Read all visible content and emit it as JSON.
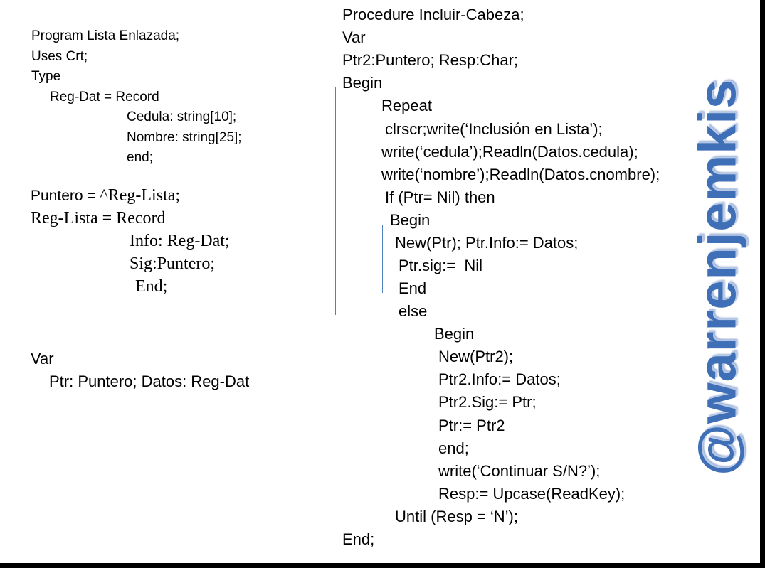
{
  "left_code": {
    "program": "Program Lista Enlazada;",
    "uses": "Uses Crt;",
    "type": "Type",
    "regdat": "Reg-Dat = Record",
    "cedula": "Cedula: string[10];",
    "nombre": "Nombre: string[25];",
    "end1": "end;",
    "puntero_a": "Puntero = ",
    "puntero_b": "^Reg-Lista;",
    "reglista": "Reg-Lista = Record",
    "info": "Info: Reg-Dat;",
    "sig": "Sig:Puntero;",
    "end2": "End;",
    "var": "Var",
    "vardecl": "Ptr: Puntero; Datos: Reg-Dat"
  },
  "right_code": {
    "l01": "Procedure Incluir-Cabeza;",
    "l02": "Var",
    "l03": "Ptr2:Puntero; Resp:Char;",
    "l04": "Begin",
    "l05": "Repeat",
    "l06": "clrscr;write(‘Inclusión en Lista’);",
    "l07": "write(‘cedula’);Readln(Datos.cedula);",
    "l08": "write(‘nombre’);Readln(Datos.cnombre);",
    "l09": "If (Ptr= Nil) then",
    "l10": "Begin",
    "l11": "New(Ptr); Ptr.Info:= Datos;",
    "l12": "Ptr.sig:=  Nil",
    "l13": "End",
    "l14": "else",
    "l15": "Begin",
    "l16": "New(Ptr2);",
    "l17": "Ptr2.Info:= Datos;",
    "l18": "Ptr2.Sig:= Ptr;",
    "l19": "Ptr:= Ptr2",
    "l20": "end;",
    "l21": "write(‘Continuar S/N?’);",
    "l22": "Resp:= Upcase(ReadKey);",
    "l23": "Until (Resp = ‘N’);",
    "l24": "End;"
  },
  "watermark": "@warrenjemkis",
  "colors": {
    "watermark": "#3f6fb6",
    "guide_line": "#4f81bd",
    "frame": "#000000"
  }
}
